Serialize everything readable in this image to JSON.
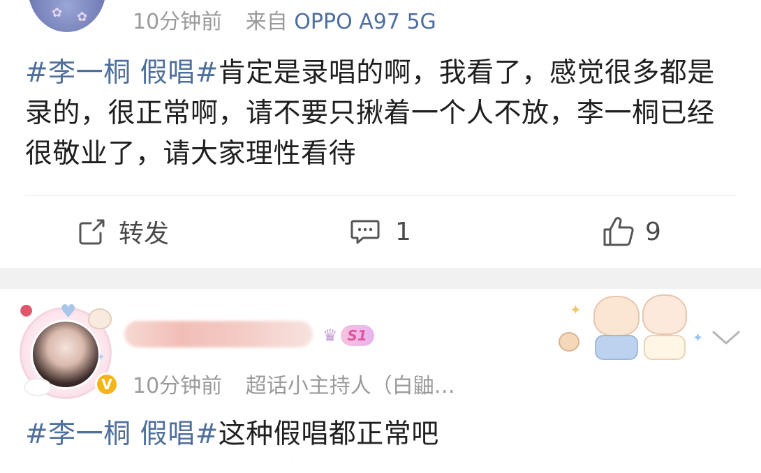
{
  "post1": {
    "time": "10分钟前",
    "source_prefix": "来自",
    "device": "OPPO A97 5G",
    "topic": "#李一桐 假唱#",
    "text": "肯定是录唱的啊，我看了，感觉很多都是录的，很正常啊，请不要只揪着一个人不放，李一桐已经很敬业了，请大家理性看待",
    "actions": {
      "repost_label": "转发",
      "comment_count": "1",
      "like_count": "9"
    }
  },
  "post2": {
    "time": "10分钟前",
    "role": "超话小主持人（白鼬…",
    "level_badge": "S1",
    "verified_mark": "V",
    "topic": "#李一桐 假唱#",
    "text": "这种假唱都正常吧"
  },
  "icons": {
    "repost": "edit-share-icon",
    "comment": "comment-icon",
    "like": "thumbs-up-icon",
    "more": "chevron-down-icon"
  },
  "colors": {
    "topic": "#4f6f9c",
    "meta": "#9a9a9a",
    "separator": "#f1f1f1",
    "verified": "#f3b51a"
  }
}
